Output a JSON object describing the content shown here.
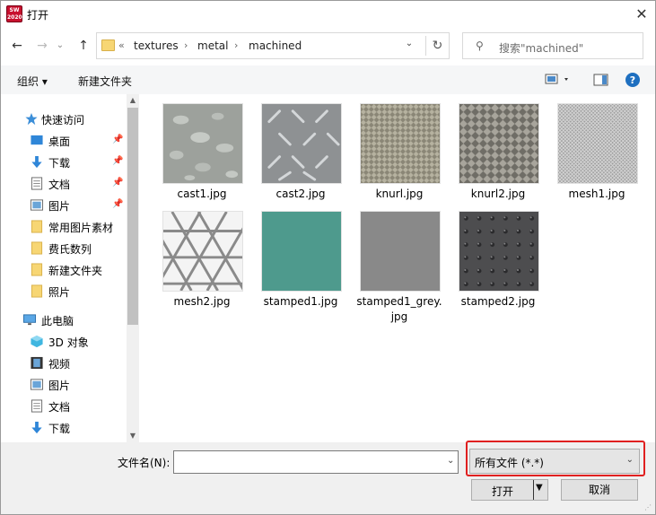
{
  "window": {
    "title": "打开",
    "app_icon_text": "SW 2020",
    "close_glyph": "✕"
  },
  "nav": {
    "back": "←",
    "forward": "→",
    "dropdown": "⌄",
    "up": "↑"
  },
  "path": {
    "overflow": "«",
    "crumbs": [
      "textures",
      "metal",
      "machined"
    ],
    "sep": "›",
    "dropdown": "⌄",
    "refresh": "↻"
  },
  "search": {
    "placeholder": "搜索\"machined\""
  },
  "toolbar": {
    "organize": "组织 ▾",
    "new_folder": "新建文件夹",
    "help": "?"
  },
  "sidebar": {
    "quick_access": "快速访问",
    "items": [
      "桌面",
      "下载",
      "文档",
      "图片",
      "常用图片素材",
      "费氏数列",
      "新建文件夹",
      "照片"
    ],
    "this_pc": "此电脑",
    "pc_items": [
      "3D 对象",
      "视频",
      "图片",
      "文档",
      "下载"
    ]
  },
  "files": [
    {
      "name": "cast1.jpg",
      "texture": "cast"
    },
    {
      "name": "cast2.jpg",
      "texture": "diamondplate"
    },
    {
      "name": "knurl.jpg",
      "texture": "knurl"
    },
    {
      "name": "knurl2.jpg",
      "texture": "knurl2"
    },
    {
      "name": "mesh1.jpg",
      "texture": "mesh"
    },
    {
      "name": "mesh2.jpg",
      "texture": "triangle"
    },
    {
      "name": "stamped1.jpg",
      "texture": "teal"
    },
    {
      "name": "stamped1_grey.\njpg",
      "texture": "grey"
    },
    {
      "name": "stamped2.jpg",
      "texture": "dots"
    }
  ],
  "bottom": {
    "filename_label": "文件名(N):",
    "filename_value": "",
    "filter": "所有文件 (*.*)",
    "open": "打开",
    "cancel": "取消"
  }
}
